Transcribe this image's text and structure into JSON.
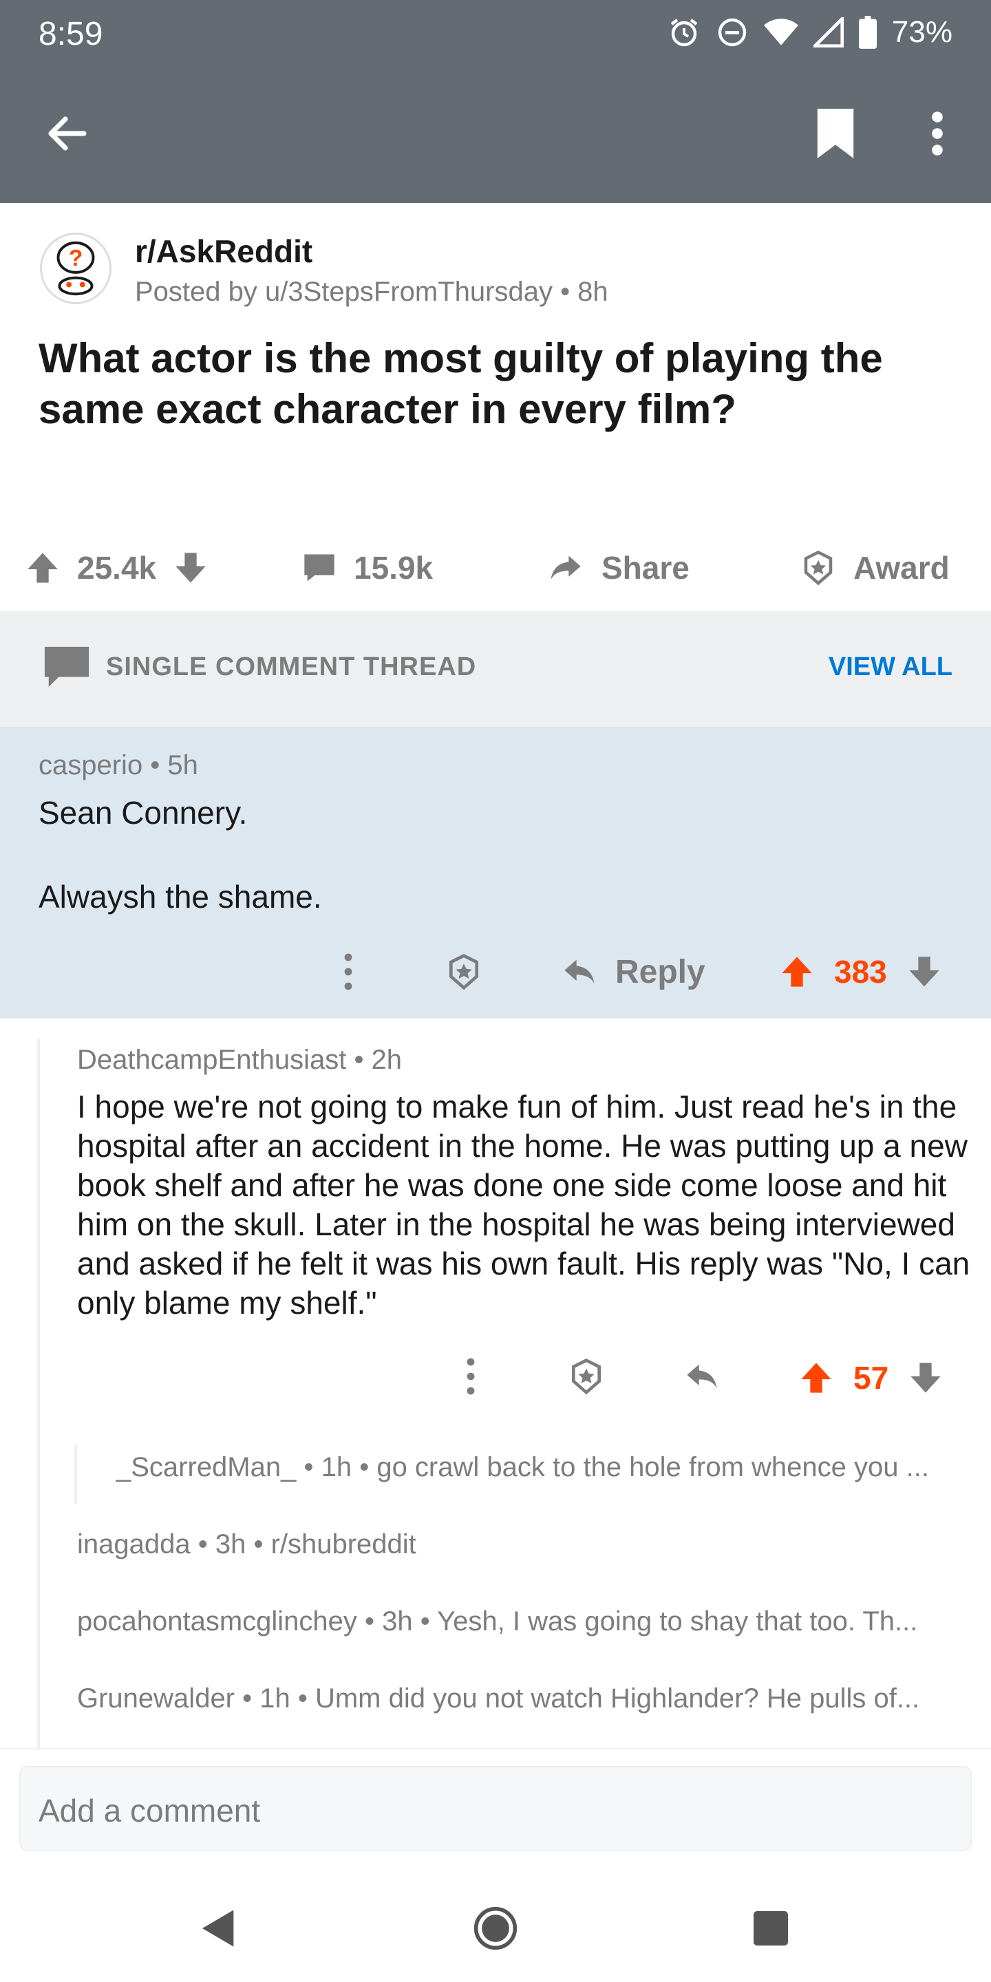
{
  "status_bar": {
    "time": "8:59",
    "battery": "73%"
  },
  "post": {
    "subreddit": "r/AskReddit",
    "posted_by": "Posted by u/3StepsFromThursday • 8h",
    "title": "What actor is the most guilty of playing the same exact character in every film?",
    "upvotes": "25.4k",
    "comments": "15.9k",
    "share_label": "Share",
    "award_label": "Award"
  },
  "thread": {
    "label": "SINGLE COMMENT THREAD",
    "view_all": "VIEW ALL"
  },
  "main_comment": {
    "meta": "casperio • 5h",
    "line1": "Sean Connery.",
    "line2": "Alwaysh the shame.",
    "reply_label": "Reply",
    "score": "383"
  },
  "reply_comment": {
    "meta": "DeathcampEnthusiast • 2h",
    "body": "I hope we're not going to make fun of him. Just read he's in the hospital after an accident in the home. He was putting up a new book shelf and after he was done one side come loose and hit him on the skull. Later in the hospital he was being interviewed and asked if he felt it was his own fault. His reply was \"No, I can only blame my shelf.\"",
    "score": "57"
  },
  "collapsed_comments": [
    "_ScarredMan_ • 1h • go crawl back to the hole from whence you ...",
    "inagadda • 3h • r/shubreddit",
    "pocahontasmcglinchey • 3h • Yesh, I was going to shay that too. Th...",
    "Grunewalder • 1h • Umm did you not watch Highlander? He pulls of..."
  ],
  "composer": {
    "placeholder": "Add a comment"
  },
  "colors": {
    "bar": "#656b73",
    "upvote": "#ff4500",
    "link": "#0079d3",
    "highlight": "#dce7f0"
  }
}
